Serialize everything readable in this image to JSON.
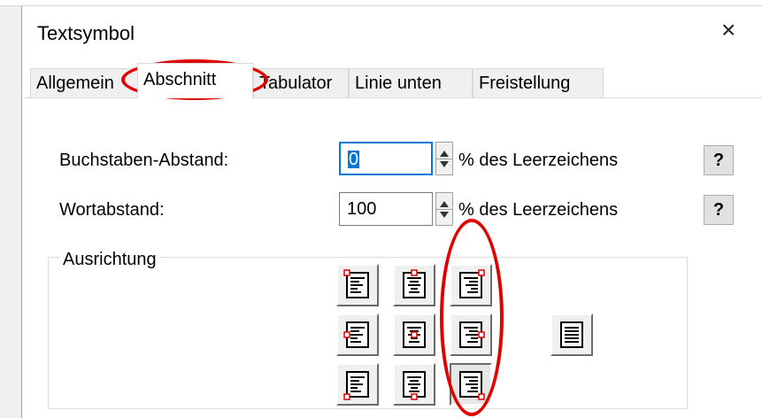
{
  "dialog": {
    "title": "Textsymbol",
    "close_glyph": "×"
  },
  "tabs": [
    {
      "label": "Allgemein",
      "active": false
    },
    {
      "label": "Abschnitt",
      "active": true
    },
    {
      "label": "Tabulator",
      "active": false
    },
    {
      "label": "Linie unten",
      "active": false
    },
    {
      "label": "Freistellung",
      "active": false
    }
  ],
  "fields": {
    "letter_spacing": {
      "label": "Buchstaben-Abstand:",
      "value": "0",
      "unit": "% des Leerzeichens",
      "help": "?"
    },
    "word_spacing": {
      "label": "Wortabstand:",
      "value": "100",
      "unit": "% des Leerzeichens",
      "help": "?"
    }
  },
  "alignment": {
    "title": "Ausrichtung",
    "grid": [
      [
        "top-left",
        "top-center",
        "top-right"
      ],
      [
        "middle-left",
        "middle-center",
        "middle-right"
      ],
      [
        "bottom-left",
        "bottom-center",
        "bottom-right"
      ]
    ],
    "justify_icon": "justify-icon"
  },
  "annotation_color": "#e00000",
  "accent_color": "#0078d7"
}
